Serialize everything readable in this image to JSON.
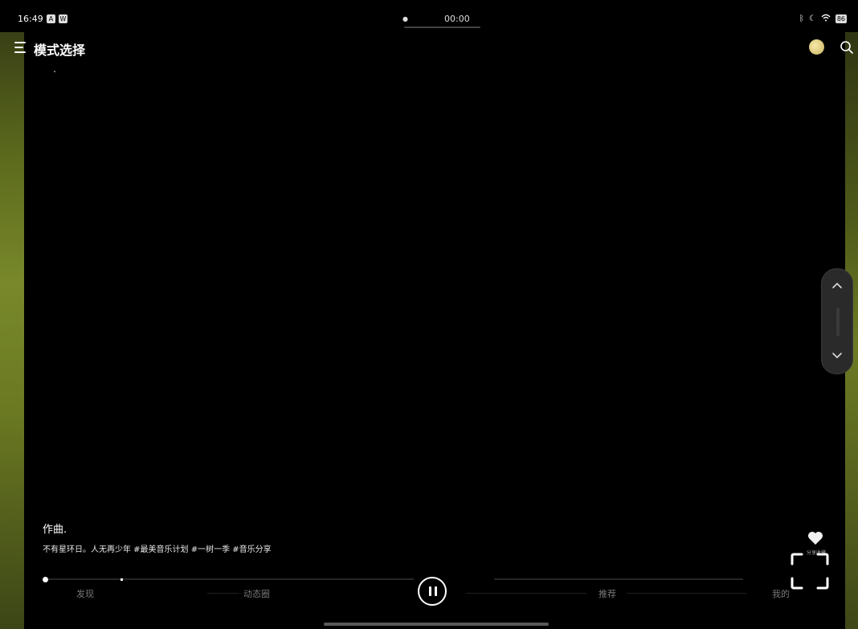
{
  "status_bar": {
    "time": "16:49",
    "app_icons": [
      "A",
      "W"
    ],
    "center_time": "00:00",
    "battery": "86"
  },
  "header": {
    "title": "模式选择",
    "icons": [
      "menu-icon",
      "avatar",
      "search-icon"
    ]
  },
  "video": {
    "author": "作曲.",
    "description": "不有星环日。人无再少年 #最美音乐计划 #一树一季 #音乐分享",
    "like_label": "分享收藏"
  },
  "bottom_nav": {
    "items": [
      "发现",
      "动态圈",
      "推荐",
      "我的"
    ]
  },
  "playback": {
    "progress": 0.0,
    "state": "playing"
  },
  "colors": {
    "background": "#000000",
    "accent": "#ffffff",
    "side_glow": "#78882a"
  }
}
